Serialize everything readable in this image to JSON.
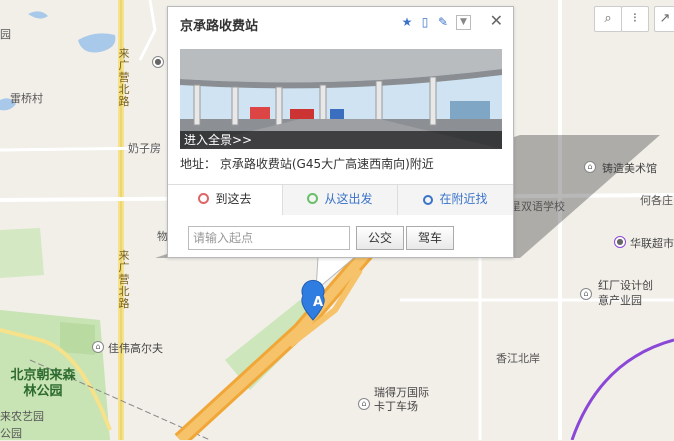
{
  "map": {
    "labels": {
      "leiqiao": "雷桥村",
      "naizifang": "奶子房",
      "road_north": "来广营北路",
      "road_south": "来广营北路",
      "jiawei": "佳伟高尔夫",
      "park": "北京朝来森林公园",
      "nongyi": "来农艺园",
      "gongyuan": "公园",
      "zhuzao": "铸造美术馆",
      "shuangyu": "星双语学校",
      "hege": "何各庄",
      "hualian": "华联超市",
      "hongchang": "红厂设计创意产业园",
      "xiangjiang": "香江北岸",
      "ruide": "瑞得万国际卡丁车场",
      "yuan": "园",
      "wu": "物"
    },
    "controls": {
      "panorama_icon": "magnify-icon",
      "traffic_icon": "traffic-light-icon",
      "share_icon": "share-icon"
    }
  },
  "popup": {
    "title": "京承路收费站",
    "panorama_label": "进入全景>>",
    "address_label": "地址：",
    "address": "京承路收费站(G45大广高速西南向)附近",
    "tabs": [
      {
        "label": "到这去",
        "dot_color": "#e06666"
      },
      {
        "label": "从这出发",
        "dot_color": "#6abf69"
      },
      {
        "label": "在附近找",
        "icon": "search-icon"
      }
    ],
    "origin_placeholder": "请输入起点",
    "bus_label": "公交",
    "drive_label": "驾车",
    "close_label": "✕"
  },
  "marker": {
    "label": "A"
  }
}
